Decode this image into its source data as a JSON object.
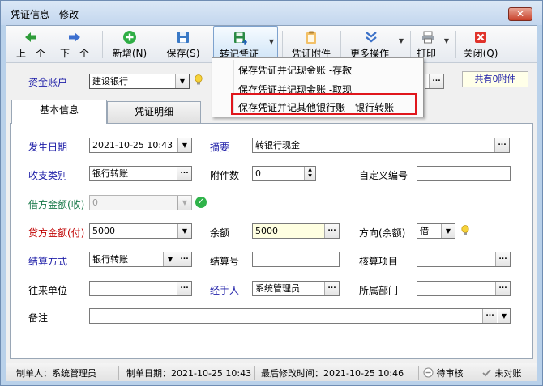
{
  "window": {
    "title": "凭证信息 - 修改",
    "close_glyph": "✕"
  },
  "toolbar": {
    "prev": "上一个",
    "next": "下一个",
    "new": "新增(N)",
    "save": "保存(S)",
    "transfer": "转记凭证",
    "attachment": "凭证附件",
    "more": "更多操作",
    "print": "打印",
    "close": "关闭(Q)"
  },
  "account": {
    "label": "资金账户",
    "value": "建设银行",
    "attach_link": "共有0附件"
  },
  "tabs": {
    "basic": "基本信息",
    "detail": "凭证明细"
  },
  "form": {
    "date_label": "发生日期",
    "date_value": "2021-10-25 10:43",
    "summary_label": "摘要",
    "summary_value": "转银行现金",
    "category_label": "收支类别",
    "category_value": "银行转账",
    "attach_count_label": "附件数",
    "attach_count_value": "0",
    "custom_no_label": "自定义编号",
    "custom_no_value": "",
    "debit_label": "借方金额(收)",
    "debit_value": "0",
    "credit_label": "贷方金额(付)",
    "credit_value": "5000",
    "balance_label": "余额",
    "balance_value": "5000",
    "direction_label": "方向(余额)",
    "direction_value": "借",
    "settle_label": "结算方式",
    "settle_value": "银行转账",
    "settle_no_label": "结算号",
    "settle_no_value": "",
    "audit_item_label": "核算项目",
    "audit_item_value": "",
    "partner_label": "往来单位",
    "partner_value": "",
    "handler_label": "经手人",
    "handler_value": "系统管理员",
    "dept_label": "所属部门",
    "dept_value": "",
    "remark_label": "备注",
    "remark_value": ""
  },
  "menu": {
    "items": [
      "保存凭证并记现金账 -存款",
      "保存凭证并记现金账 -取现",
      "保存凭证并记其他银行账 - 银行转账"
    ]
  },
  "status": {
    "creator": "制单人：系统管理员",
    "created": "制单日期：2021-10-25 10:43",
    "modified": "最后修改时间：2021-10-25 10:46",
    "pending": "待审核",
    "unreconciled": "未对账"
  },
  "colors": {
    "accent_blue": "#1f1fa8",
    "accent_red": "#c00000",
    "highlight_red": "#e0161c"
  },
  "icons": [
    "arrow-left-icon",
    "arrow-right-icon",
    "plus-circle-icon",
    "floppy-icon",
    "floppy-transfer-icon",
    "clipboard-icon",
    "double-chevron-icon",
    "printer-icon",
    "close-red-icon",
    "bulb-icon",
    "check-circle-icon",
    "ellipsis-icon",
    "chevron-down-icon"
  ]
}
